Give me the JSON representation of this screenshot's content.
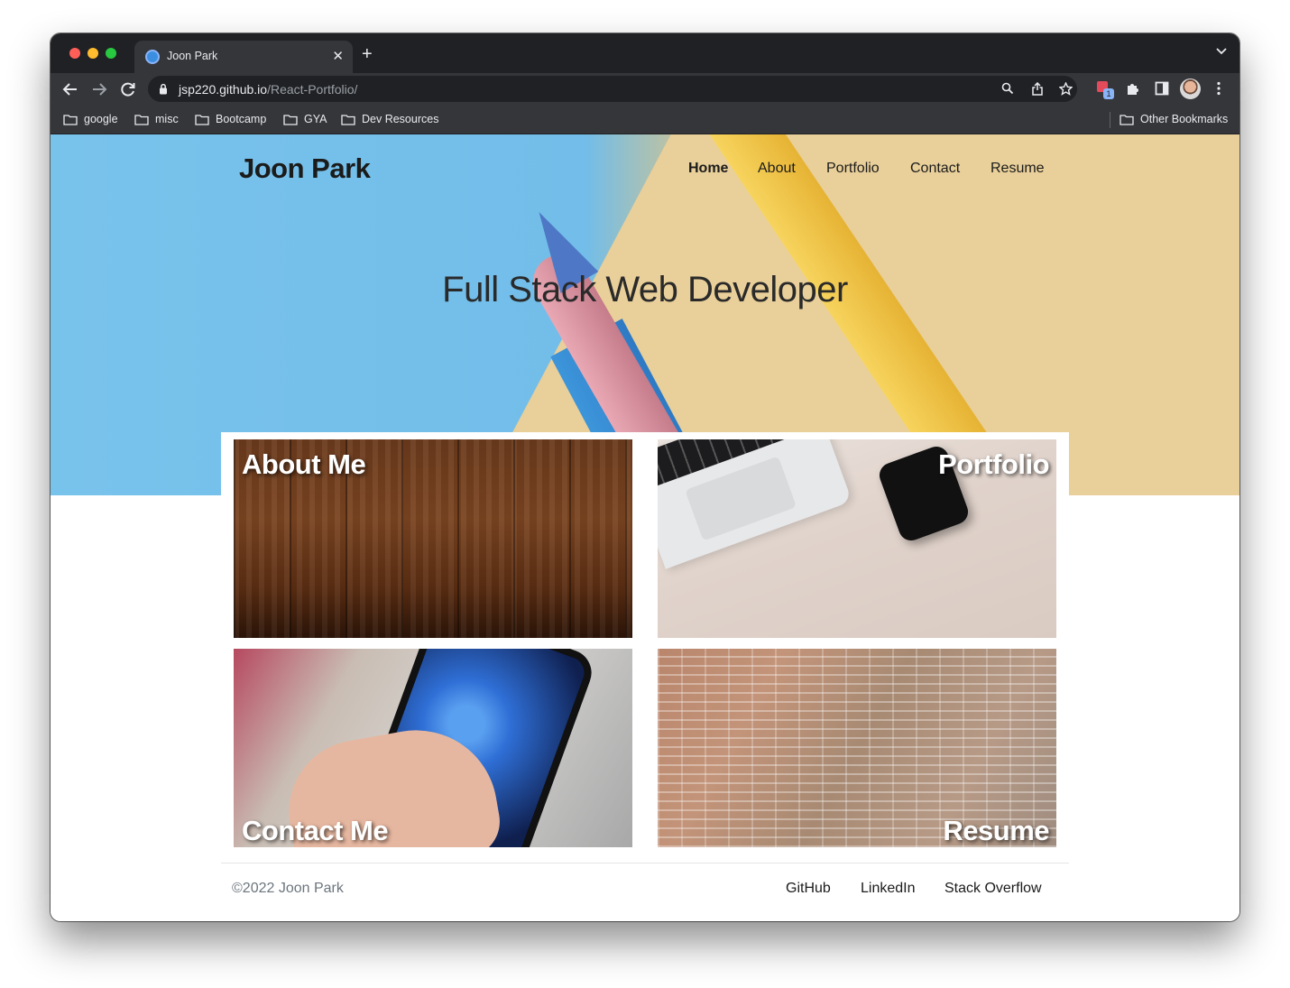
{
  "browser": {
    "tab_title": "Joon Park",
    "url_host": "jsp220.github.io",
    "url_path": "/React-Portfolio/",
    "bookmarks": [
      "google",
      "misc",
      "Bootcamp",
      "GYA",
      "Dev Resources"
    ],
    "other_bookmarks": "Other Bookmarks",
    "extension_badge": "1"
  },
  "site": {
    "brand": "Joon Park",
    "nav": [
      "Home",
      "About",
      "Portfolio",
      "Contact",
      "Resume"
    ],
    "active_nav": "Home",
    "hero_title": "Full Stack Web Developer",
    "cards": {
      "about": "About Me",
      "portfolio": "Portfolio",
      "contact": "Contact Me",
      "resume": "Resume"
    },
    "footer": {
      "copyright": "©2022 Joon Park",
      "links": [
        "GitHub",
        "LinkedIn",
        "Stack Overflow"
      ]
    }
  }
}
